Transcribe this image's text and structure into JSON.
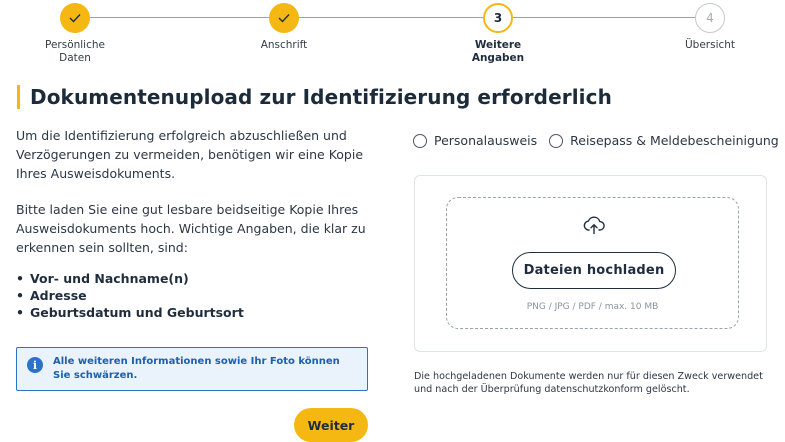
{
  "stepper": {
    "steps": [
      {
        "number": "",
        "label": "Persönliche\nDaten",
        "state": "done"
      },
      {
        "number": "",
        "label": "Anschrift",
        "state": "done"
      },
      {
        "number": "3",
        "label": "Weitere\nAngaben",
        "state": "current"
      },
      {
        "number": "4",
        "label": "Übersicht",
        "state": "todo"
      }
    ]
  },
  "heading": "Dokumentenupload zur Identifizierung erforderlich",
  "intro": {
    "paragraph1": "Um die Identifizierung erfolgreich abzuschließen und Verzögerungen zu vermeiden, benötigen wir eine Kopie Ihres Ausweisdokuments.",
    "paragraph2": "Bitte laden Sie eine gut lesbare beidseitige Kopie Ihres Ausweisdokuments hoch. Wichtige Angaben, die klar zu erkennen sein sollten, sind:",
    "bullets": [
      "Vor- und Nachname(n)",
      "Adresse",
      "Geburtsdatum und Geburtsort"
    ]
  },
  "info_box": {
    "icon": "info-icon",
    "text": "Alle weiteren Informationen sowie Ihr Foto können Sie schwärzen."
  },
  "actions": {
    "next_label": "Weiter"
  },
  "document_type": {
    "options": [
      "Personalausweis",
      "Reisepass & Meldebescheinigung"
    ],
    "selected": null
  },
  "upload": {
    "icon": "cloud-upload-icon",
    "button_label": "Dateien hochladen",
    "hint": "PNG / JPG / PDF / max. 10 MB"
  },
  "privacy_note": "Die hochgeladenen Dokumente werden nur für diesen Zweck verwendet und nach der Überprüfung datenschutzkonform gelöscht.",
  "colors": {
    "accent": "#f5b813",
    "info": "#2b73c6",
    "info_bg": "#eaf2fb",
    "text": "#1f2d3d"
  }
}
